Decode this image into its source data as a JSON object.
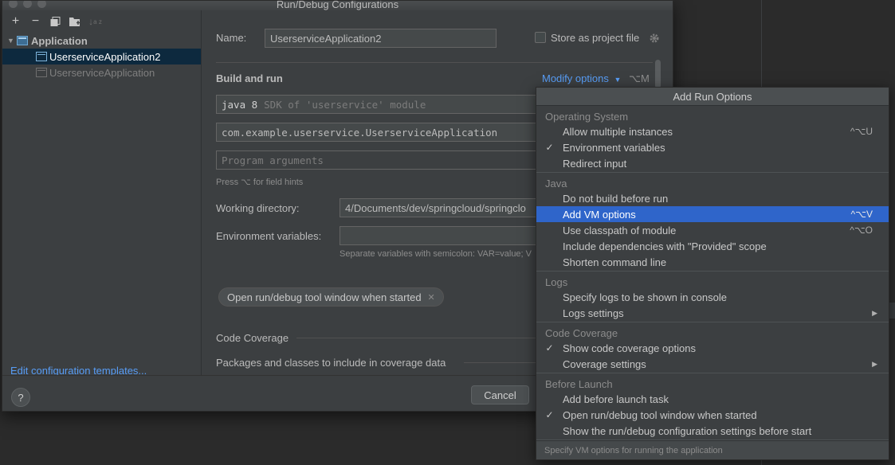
{
  "window": {
    "title": "Run/Debug Configurations"
  },
  "toolbar": {
    "add_icon": "plus-icon",
    "remove_icon": "minus-icon",
    "copy_icon": "copy-icon",
    "folder_icon": "new-folder-icon",
    "sort_icon": "sort-icon"
  },
  "tree": {
    "group_label": "Application",
    "items": [
      {
        "label": "UserserviceApplication2",
        "selected": true
      },
      {
        "label": "UserserviceApplication",
        "selected": false
      }
    ]
  },
  "edit_templates_label": "Edit configuration templates...",
  "form": {
    "name_label": "Name:",
    "name_value": "UserserviceApplication2",
    "store_label": "Store as project file",
    "build_run_title": "Build and run",
    "modify_options_label": "Modify options",
    "modify_options_shortcut": "⌥M",
    "jre_value": "java 8",
    "jre_hint": "SDK of 'userservice' module",
    "main_class_value": "com.example.userservice.UserserviceApplication",
    "program_args_placeholder": "Program arguments",
    "field_hints_text": "Press ⌥ for field hints",
    "working_dir_label": "Working directory:",
    "working_dir_value": "4/Documents/dev/springcloud/springclo",
    "env_vars_label": "Environment variables:",
    "env_vars_hint": "Separate variables with semicolon: VAR=value; V",
    "chip_label": "Open run/debug tool window when started",
    "code_coverage_title": "Code Coverage",
    "coverage_packages_label": "Packages and classes to include in coverage data"
  },
  "buttons": {
    "help": "?",
    "cancel": "Cancel"
  },
  "popup": {
    "title": "Add Run Options",
    "groups": [
      {
        "title": "Operating System",
        "items": [
          {
            "label": "Allow multiple instances",
            "checked": false,
            "shortcut": "^⌥U"
          },
          {
            "label": "Environment variables",
            "checked": true,
            "shortcut": ""
          },
          {
            "label": "Redirect input",
            "checked": false,
            "shortcut": ""
          }
        ]
      },
      {
        "title": "Java",
        "items": [
          {
            "label": "Do not build before run",
            "checked": false,
            "shortcut": ""
          },
          {
            "label": "Add VM options",
            "checked": false,
            "shortcut": "^⌥V",
            "highlighted": true
          },
          {
            "label": "Use classpath of module",
            "checked": false,
            "shortcut": "^⌥O"
          },
          {
            "label": "Include dependencies with \"Provided\" scope",
            "checked": false,
            "shortcut": ""
          },
          {
            "label": "Shorten command line",
            "checked": false,
            "shortcut": ""
          }
        ]
      },
      {
        "title": "Logs",
        "items": [
          {
            "label": "Specify logs to be shown in console",
            "checked": false,
            "shortcut": ""
          },
          {
            "label": "Logs settings",
            "checked": false,
            "shortcut": "",
            "submenu": true
          }
        ]
      },
      {
        "title": "Code Coverage",
        "items": [
          {
            "label": "Show code coverage options",
            "checked": true,
            "shortcut": ""
          },
          {
            "label": "Coverage settings",
            "checked": false,
            "shortcut": "",
            "submenu": true
          }
        ]
      },
      {
        "title": "Before Launch",
        "items": [
          {
            "label": "Add before launch task",
            "checked": false,
            "shortcut": ""
          },
          {
            "label": "Open run/debug tool window when started",
            "checked": true,
            "shortcut": ""
          },
          {
            "label": "Show the run/debug configuration settings before start",
            "checked": false,
            "shortcut": ""
          }
        ]
      }
    ],
    "footer": "Specify VM options for running the application"
  }
}
